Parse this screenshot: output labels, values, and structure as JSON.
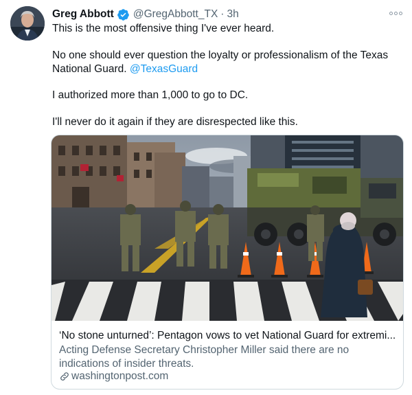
{
  "tweet": {
    "author": {
      "name": "Greg Abbott",
      "handle": "@GregAbbott_TX",
      "separator": "·",
      "time": "3h",
      "verified": true,
      "avatar_icon": "profile-photo",
      "verified_icon": "verified-badge-icon"
    },
    "more_icon": "more-options-icon",
    "body": {
      "line1": "This is the most offensive thing I've ever heard.",
      "line2": "No one should ever question the loyalty or professionalism of the Texas",
      "line3_text": "National Guard.",
      "line3_mention": "@TexasGuard",
      "line4": "I authorized more than 1,000 to go to DC.",
      "line5": "I'll never do it again if they are disrespected like this."
    },
    "link_card": {
      "title": "‘No stone unturned’: Pentagon vows to vet National Guard for extremi...",
      "description": "Acting Defense Secretary Christopher Miller said there are no indications of insider threats.",
      "domain": "washingtonpost.com",
      "link_icon": "link-icon"
    }
  },
  "colors": {
    "text_primary": "#0f1419",
    "text_secondary": "#536471",
    "accent": "#1d9bf0",
    "card_border": "#cfd9de"
  }
}
